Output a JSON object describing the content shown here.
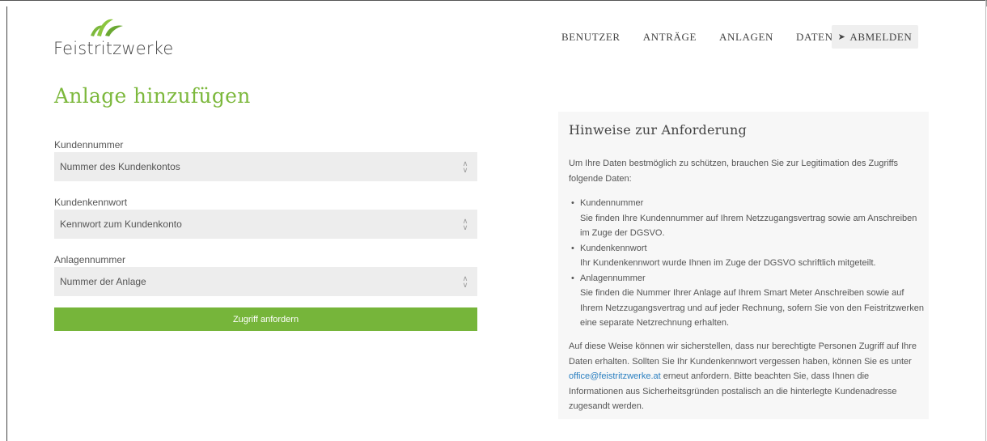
{
  "brand": {
    "name": "Feistritzwerke",
    "accent": "#7cb83c",
    "button_color": "#76b53a"
  },
  "nav": {
    "items": [
      "BENUTZER",
      "ANTRÄGE",
      "ANLAGEN",
      "DATEN"
    ],
    "logout_label": "ABMELDEN",
    "logout_icon": "sign-out-icon"
  },
  "form": {
    "title": "Anlage hinzufügen",
    "fields": [
      {
        "label": "Kundennummer",
        "placeholder": "Nummer des Kundenkontos"
      },
      {
        "label": "Kundenkennwort",
        "placeholder": "Kennwort zum Kundenkonto"
      },
      {
        "label": "Anlagennummer",
        "placeholder": "Nummer der Anlage"
      }
    ],
    "submit_label": "Zugriff anfordern"
  },
  "info": {
    "title": "Hinweise zur Anforderung",
    "intro": "Um Ihre Daten bestmöglich zu schützen, brauchen Sie zur Legitimation des Zugriffs folgende Daten:",
    "bullets": [
      {
        "title": "Kundennummer",
        "text": "Sie finden Ihre Kundennummer auf Ihrem Netzzugangsvertrag sowie am Anschreiben im Zuge der DGSVO."
      },
      {
        "title": "Kundenkennwort",
        "text": "Ihr Kundenkennwort wurde Ihnen im Zuge der DGSVO schriftlich mitgeteilt."
      },
      {
        "title": "Anlagennummer",
        "text": "Sie finden die Nummer Ihrer Anlage auf Ihrem Smart Meter Anschreiben sowie auf Ihrem Netzzugangsvertrag und auf jeder Rechnung, sofern Sie von den Feistritzwerken eine separate Netzrechnung erhalten."
      }
    ],
    "outro_before": "Auf diese Weise können wir sicherstellen, dass nur berechtigte Personen Zugriff auf Ihre Daten erhalten. Sollten Sie Ihr Kundenkennwort vergessen haben, können Sie es unter ",
    "email": "office@feistritzwerke.at",
    "outro_after": " erneut anfordern. Bitte beachten Sie, dass Ihnen die Informationen aus Sicherheitsgründen postalisch an die hinterlegte Kundenadresse zugesandt werden."
  }
}
